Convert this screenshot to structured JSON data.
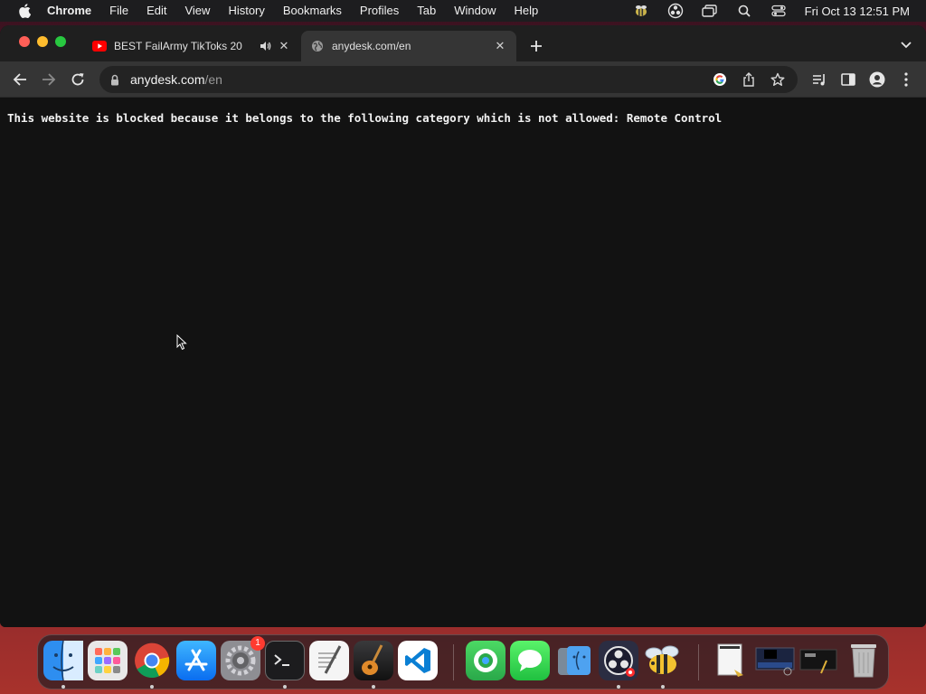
{
  "menubar": {
    "app_name": "Chrome",
    "items": [
      "File",
      "Edit",
      "View",
      "History",
      "Bookmarks",
      "Profiles",
      "Tab",
      "Window",
      "Help"
    ],
    "status_icons": [
      "bee-icon",
      "obs-icon",
      "screen-mirror-icon",
      "spotlight-search-icon",
      "control-center-icon"
    ],
    "clock": "Fri Oct 13  12:51 PM"
  },
  "tabs": [
    {
      "title": "BEST FailArmy TikToks 20",
      "icon": "youtube-icon",
      "audio": true,
      "active": false
    },
    {
      "title": "anydesk.com/en",
      "icon": "globe-icon",
      "audio": false,
      "active": true
    }
  ],
  "omnibox": {
    "host": "anydesk.com",
    "path": "/en"
  },
  "page": {
    "message": "This website is blocked because it belongs to the following category which is not allowed: Remote Control"
  },
  "dock": {
    "apps": [
      "Finder",
      "Launchpad",
      "Google Chrome",
      "App Store",
      "System Settings",
      "Terminal",
      "TextEdit",
      "GarageBand",
      "Visual Studio Code",
      "Find My",
      "Messages",
      "Migration Assistant",
      "OBS",
      "Bee"
    ],
    "badge_settings": "1",
    "recent": [
      "Document",
      "Window preview",
      "Screen recording"
    ]
  },
  "colors": {
    "page_bg": "#121212",
    "toolbar_bg": "#353535",
    "accent_close": "#ff5f57"
  }
}
